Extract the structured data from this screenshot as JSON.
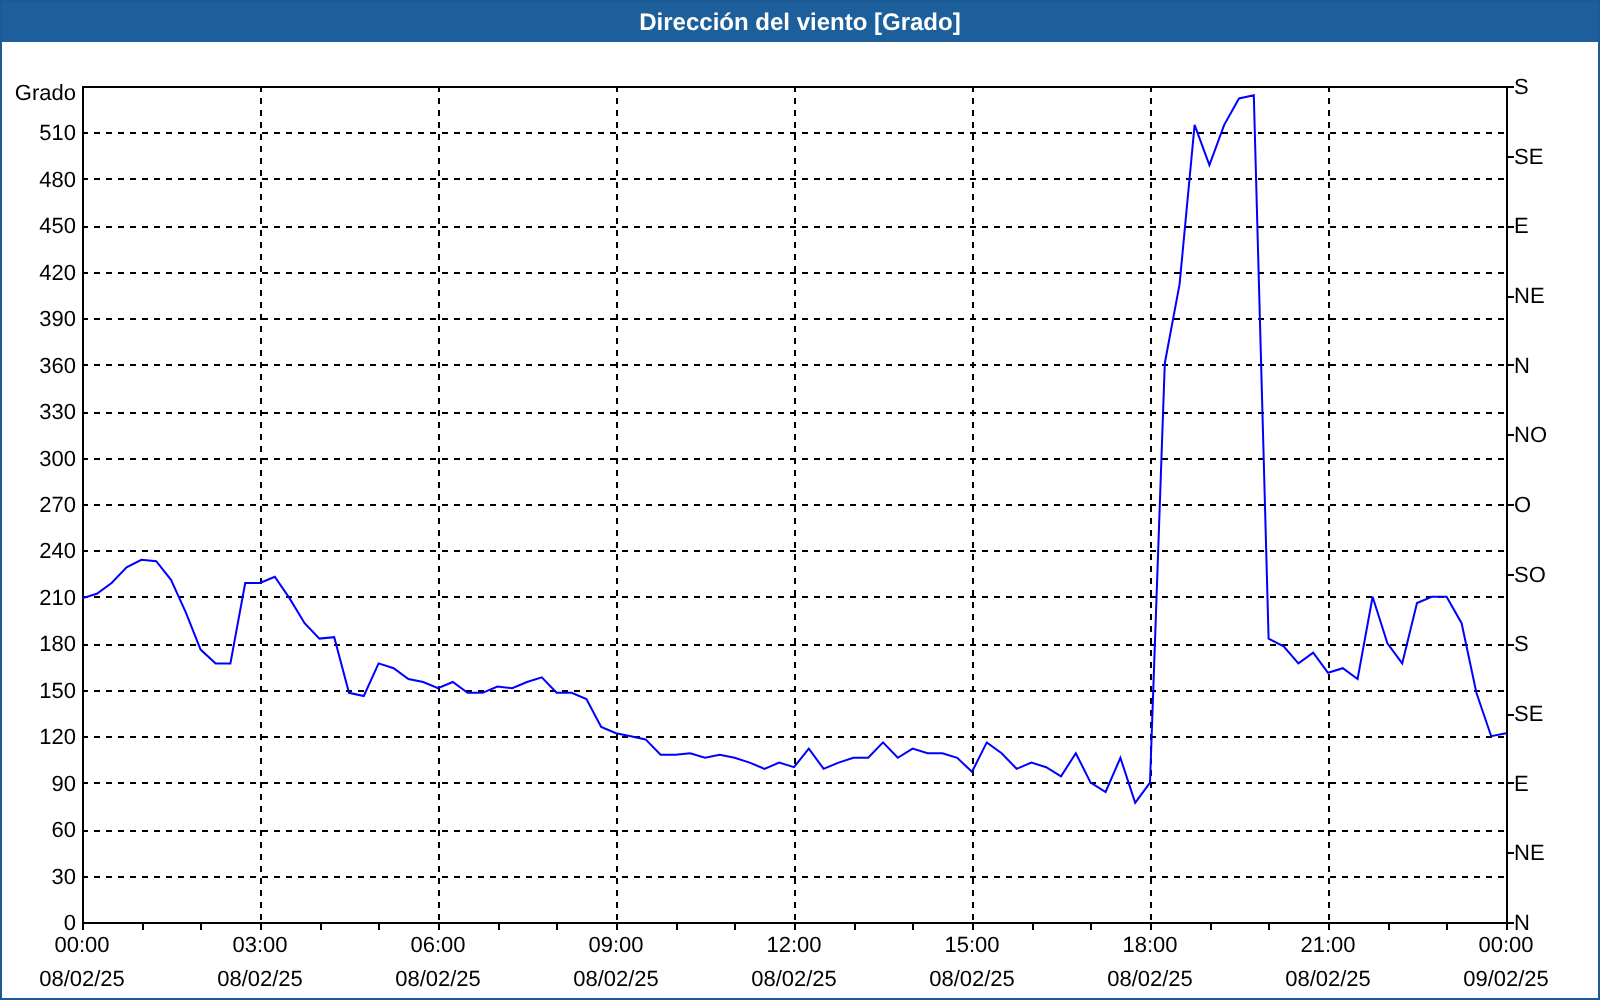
{
  "window": {
    "title": "Dirección del viento [Grado]"
  },
  "chart": {
    "chart_data": {
      "type": "line",
      "grid": true,
      "ylabel": "Grado",
      "ylim": [
        0,
        540
      ],
      "categories": [
        "00:00\n08/02/25",
        null,
        null,
        null,
        null,
        null,
        null,
        null,
        null,
        null,
        null,
        null,
        "03:00\n08/02/25",
        null,
        null,
        null,
        null,
        null,
        null,
        null,
        null,
        null,
        null,
        null,
        "06:00\n08/02/25",
        null,
        null,
        null,
        null,
        null,
        null,
        null,
        null,
        null,
        null,
        null,
        "09:00\n08/02/25",
        null,
        null,
        null,
        null,
        null,
        null,
        null,
        null,
        null,
        null,
        null,
        "12:00\n08/02/25",
        null,
        null,
        null,
        null,
        null,
        null,
        null,
        null,
        null,
        null,
        null,
        "15:00\n08/02/25",
        null,
        null,
        null,
        null,
        null,
        null,
        null,
        null,
        null,
        null,
        null,
        "18:00\n08/02/25",
        null,
        null,
        null,
        null,
        null,
        null,
        null,
        null,
        null,
        null,
        null,
        "21:00\n08/02/25",
        null,
        null,
        null,
        null,
        null,
        null,
        null,
        null,
        null,
        null,
        null,
        "00:00\n09/02/25"
      ],
      "series": [
        {
          "color": "#0000ff",
          "values": [
            209,
            212,
            219,
            229,
            234,
            233,
            221,
            200,
            176,
            167,
            167,
            219,
            219,
            223,
            209,
            193,
            183,
            184,
            148,
            146,
            167,
            164,
            157,
            155,
            151,
            155,
            148,
            148,
            152,
            151,
            155,
            158,
            148,
            148,
            144,
            126,
            122,
            120,
            118,
            108,
            108,
            109,
            106,
            108,
            106,
            103,
            99,
            103,
            100,
            112,
            99,
            103,
            106,
            106,
            116,
            106,
            112,
            109,
            109,
            106,
            97,
            116,
            109,
            99,
            103,
            100,
            94,
            109,
            90,
            84,
            106,
            77,
            90,
            361,
            412,
            515,
            489,
            515,
            532,
            534,
            183,
            178,
            167,
            174,
            161,
            164,
            157,
            210,
            180,
            167,
            206,
            210,
            210,
            193,
            148,
            120,
            122
          ]
        }
      ],
      "yticks": [
        0,
        30,
        60,
        90,
        120,
        150,
        180,
        210,
        240,
        270,
        300,
        330,
        360,
        390,
        420,
        450,
        480,
        510
      ]
    }
  },
  "direction_axis": {
    "labels": [
      "S",
      "SE",
      "E",
      "NE",
      "N",
      "NO",
      "O",
      "SO",
      "S",
      "SE",
      "E",
      "NE",
      "N"
    ]
  }
}
